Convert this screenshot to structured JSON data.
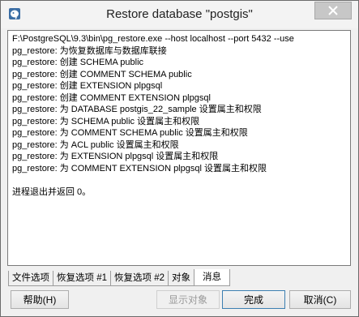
{
  "window": {
    "title": "Restore database \"postgis\""
  },
  "log": {
    "lines": [
      "F:\\PostgreSQL\\9.3\\bin\\pg_restore.exe --host localhost --port 5432 --use",
      "pg_restore: 为恢复数据库与数据库联接",
      "pg_restore: 创建 SCHEMA public",
      "pg_restore: 创建 COMMENT SCHEMA public",
      "pg_restore: 创建 EXTENSION plpgsql",
      "pg_restore: 创建 COMMENT EXTENSION plpgsql",
      "pg_restore: 为 DATABASE postgis_22_sample 设置属主和权限",
      "pg_restore: 为 SCHEMA public 设置属主和权限",
      "pg_restore: 为 COMMENT SCHEMA public 设置属主和权限",
      "pg_restore: 为 ACL public 设置属主和权限",
      "pg_restore: 为 EXTENSION plpgsql 设置属主和权限",
      "pg_restore: 为 COMMENT EXTENSION plpgsql 设置属主和权限"
    ],
    "footer": "进程退出并返回 0。"
  },
  "tabs": {
    "file_options": "文件选项",
    "restore_options_1": "恢复选项 #1",
    "restore_options_2": "恢复选项 #2",
    "objects": "对象",
    "messages": "消息"
  },
  "buttons": {
    "help": "帮助(H)",
    "display_objects": "显示对象",
    "done": "完成",
    "cancel": "取消(C)"
  }
}
